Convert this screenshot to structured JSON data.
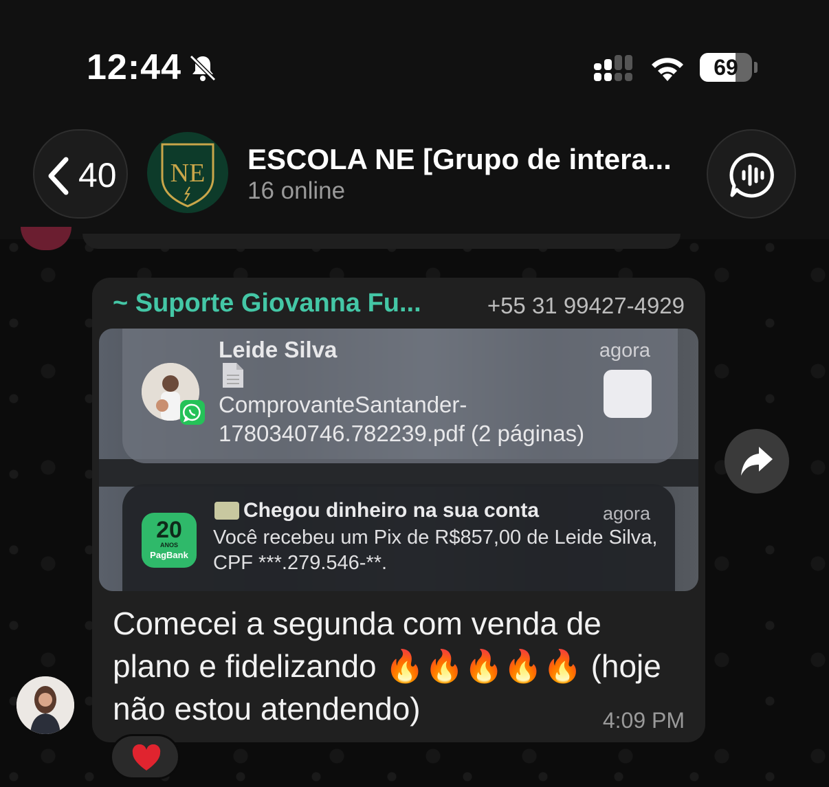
{
  "status_bar": {
    "time": "12:44",
    "battery_pct": "69",
    "battery_level": 0.69,
    "icons": [
      "bell-slash-icon",
      "cellular-signal-icon",
      "wifi-icon",
      "battery-icon"
    ]
  },
  "header": {
    "back_count": "40",
    "title": "ESCOLA NE [Grupo de intera...",
    "subtitle": "16 online",
    "avatar_monogram": "NE",
    "icons": [
      "chevron-left-icon",
      "voice-chat-icon"
    ]
  },
  "message": {
    "sender_name": "~ Suporte Giovanna Fu...",
    "sender_phone": "+55 31 99427-4929",
    "notification1": {
      "name": "Leide Silva",
      "time": "agora",
      "body": "ComprovanteSantander-1780340746.782239.pdf (2 páginas)"
    },
    "notification2": {
      "title": "Chegou dinheiro na sua conta",
      "time": "agora",
      "body": "Você recebeu um Pix de R$857,00 de Leide Silva, CPF ***.279.546-**.",
      "logo_number": "20",
      "logo_sub": "ANOS",
      "logo_brand": "PagBank"
    },
    "text": "Comecei a segunda com venda de plano e fidelizando 🔥🔥🔥🔥🔥 (hoje não estou atendendo)",
    "time": "4:09 PM",
    "reaction": "heart"
  },
  "colors": {
    "accent_green": "#44c7a6",
    "bubble_bg": "#202020",
    "header_bg": "#111111",
    "reaction_heart": "#e0242f",
    "whatsapp_green": "#25c258",
    "pagbank_green": "#2fb96a"
  }
}
